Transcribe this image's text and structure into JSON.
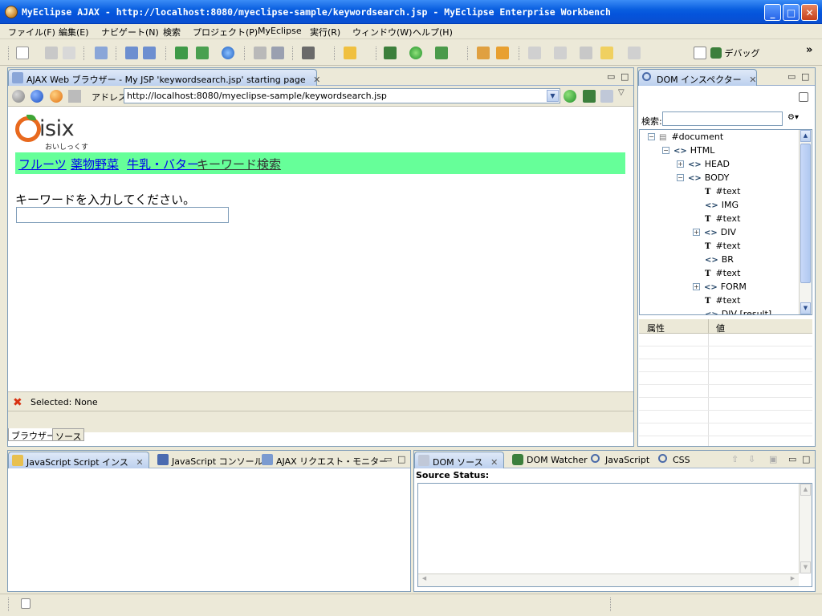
{
  "window": {
    "title": "MyEclipse AJAX - http://localhost:8080/myeclipse-sample/keywordsearch.jsp - MyEclipse Enterprise Workbench",
    "minimize": "_",
    "maximize": "□",
    "close": "✕"
  },
  "menu": [
    "ファイル(F)",
    "編集(E)",
    "ナビゲート(N)",
    "検索",
    "プロジェクト(P)",
    "MyEclipse",
    "実行(R)",
    "ウィンドウ(W)",
    "ヘルプ(H)"
  ],
  "toolbar": {
    "debug_label": "デバッグ",
    "overflow": "»"
  },
  "browser": {
    "tab_title": "AJAX Web ブラウザー - My JSP 'keywordsearch.jsp' starting page",
    "address_label": "アドレス",
    "address_value": "http://localhost:8080/myeclipse-sample/keywordsearch.jsp",
    "page": {
      "logo_text": "isix",
      "logo_sub": "おいしっくす",
      "nav_links": [
        "フルーツ",
        "薬物野菜",
        "牛乳・バター",
        "キーワード検索"
      ],
      "keyword_label": "キーワードを入力してください。",
      "keyword_value": ""
    },
    "selected_status": "Selected: None",
    "bottom_tabs": [
      "ブラウザー",
      "ソース"
    ]
  },
  "dom_inspector": {
    "tab_title": "DOM インスペクター",
    "search_label": "検索:",
    "tree": [
      {
        "label": "#document",
        "type": "doc",
        "expander": "⊟"
      },
      {
        "label": "HTML",
        "type": "tag",
        "expander": "⊟"
      },
      {
        "label": "HEAD",
        "type": "tag",
        "expander": "⊞"
      },
      {
        "label": "BODY",
        "type": "tag",
        "expander": "⊟"
      },
      {
        "label": "#text",
        "type": "text",
        "expander": ""
      },
      {
        "label": "IMG",
        "type": "tag",
        "expander": ""
      },
      {
        "label": "#text",
        "type": "text",
        "expander": ""
      },
      {
        "label": "DIV",
        "type": "tag",
        "expander": "⊞"
      },
      {
        "label": "#text",
        "type": "text",
        "expander": ""
      },
      {
        "label": "BR",
        "type": "tag",
        "expander": ""
      },
      {
        "label": "#text",
        "type": "text",
        "expander": ""
      },
      {
        "label": "FORM",
        "type": "tag",
        "expander": "⊞"
      },
      {
        "label": "#text",
        "type": "text",
        "expander": ""
      },
      {
        "label": "DIV [result]",
        "type": "tag",
        "expander": ""
      }
    ],
    "prop_col_attr": "属性",
    "prop_col_value": "値"
  },
  "bottom_left": {
    "tabs": [
      "JavaScript Script インス",
      "JavaScript コンソール",
      "AJAX リクエスト・モニター"
    ]
  },
  "bottom_right": {
    "tabs": [
      "DOM ソース",
      "DOM Watcher",
      "JavaScript",
      "CSS"
    ],
    "source_status": "Source Status:"
  }
}
